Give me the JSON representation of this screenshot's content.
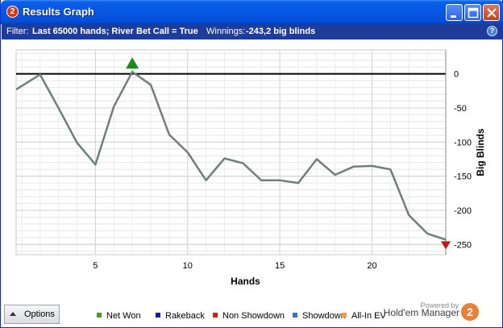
{
  "window": {
    "title": "Results Graph",
    "app_icon_glyph": "2"
  },
  "filter": {
    "prefix": "Filter:",
    "value": "Last 65000 hands; River Bet Call = True",
    "winnings_label": "Winnings:",
    "winnings_value": "-243,2 big blinds",
    "help_glyph": "?"
  },
  "chart_data": {
    "type": "line",
    "xlabel": "Hands",
    "ylabel": "Big Blinds",
    "xlim": [
      0.7,
      24
    ],
    "ylim": [
      -265,
      35
    ],
    "x_ticks": [
      5,
      10,
      15,
      20
    ],
    "y_ticks": [
      0,
      -50,
      -100,
      -150,
      -200,
      -250
    ],
    "grid": true,
    "series": [
      {
        "name": "Net Won",
        "color": "#6e7f7a",
        "x": [
          0.7,
          2,
          3,
          4,
          5,
          6,
          7,
          8,
          9,
          10,
          11,
          12,
          13,
          14,
          15,
          16,
          17,
          18,
          19,
          20,
          21,
          22,
          23,
          24
        ],
        "values": [
          -23,
          -1,
          -50,
          -101,
          -133,
          -48,
          3,
          -16,
          -89,
          -115,
          -156,
          -124,
          -131,
          -156,
          -156,
          -160,
          -125,
          -148,
          -136,
          -135,
          -140,
          -207,
          -234,
          -243
        ]
      }
    ],
    "markers": [
      {
        "type": "max",
        "x": 7,
        "y": 3,
        "color": "#1a8a1a"
      },
      {
        "type": "last",
        "x": 24,
        "y": -243,
        "color": "#cc1111"
      }
    ]
  },
  "legend": [
    {
      "label": "Net Won",
      "color": "#4c9a2a"
    },
    {
      "label": "Rakeback",
      "color": "#1515c8"
    },
    {
      "label": "Non Showdown",
      "color": "#d41a1a"
    },
    {
      "label": "Showdown",
      "color": "#3a6ee8"
    },
    {
      "label": "All-In EV",
      "color": "#f0a040"
    }
  ],
  "options_button": {
    "label": "Options"
  },
  "branding": {
    "powered": "Powered by",
    "product": "Hold'em Manager",
    "logo_glyph": "2"
  }
}
